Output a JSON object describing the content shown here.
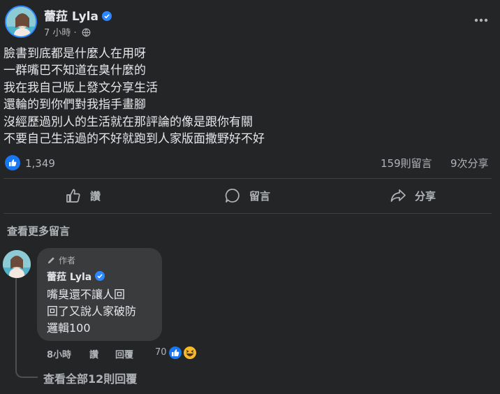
{
  "post": {
    "author": "蕾菈 Lyla",
    "time": "7 小時 · ",
    "text_lines": [
      "臉書到底都是什麼人在用呀",
      "一群嘴巴不知道在臭什麼的",
      "我在我自己版上發文分享生活",
      "還輪的到你們對我指手畫腳",
      "沒經歷過別人的生活就在那評論的像是跟你有關",
      "不要自己生活過的不好就跑到人家版面撒野好不好"
    ],
    "reactions_count": "1,349",
    "comments_count": "159則留言",
    "shares_count": "9次分享"
  },
  "actions": {
    "like": "讚",
    "comment": "留言",
    "share": "分享"
  },
  "more_comments": "查看更多留言",
  "comment": {
    "author_tag": "作者",
    "author": "蕾菈 Lyla",
    "text_lines": [
      "嘴臭還不讓人回",
      "回了又說人家破防",
      "邏輯100"
    ],
    "time": "8小時",
    "like": "讚",
    "reply": "回覆",
    "reactions_count": "70"
  },
  "view_replies": "查看全部12則回覆",
  "colors": {
    "background": "#242526",
    "bubble": "#3a3b3c",
    "accent": "#2d88ff",
    "secondary_text": "#b0b3b8"
  },
  "icons": [
    "verified-badge-icon",
    "globe-icon",
    "more-options-icon",
    "like-reaction-icon",
    "thumbs-up-icon",
    "comment-icon",
    "share-icon",
    "pencil-icon",
    "laugh-reaction-icon"
  ]
}
